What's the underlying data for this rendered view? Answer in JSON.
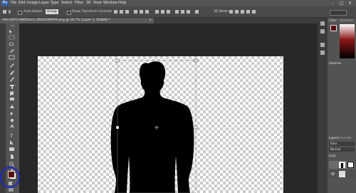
{
  "app": {
    "menus": [
      "File",
      "Edit",
      "Image",
      "Layer",
      "Type",
      "Select",
      "Filter",
      "3D",
      "View",
      "Window",
      "Help"
    ],
    "window_controls": [
      "–",
      "□",
      "✕"
    ]
  },
  "options_bar": {
    "auto_select_label": "Auto-Select:",
    "auto_select_value": "Group",
    "show_transform_label": "Show Transform Controls",
    "mode_3d_label": "3D Mode:"
  },
  "document_tab": {
    "title": "film 6075-6967lsm1-360ah5MVV9.png @ 16.7% (Layer 1, RGB/8) *",
    "close": "×"
  },
  "panels": {
    "color_tab": "Color",
    "swatches_tab": "Swatches",
    "libraries_tab": "Libraries",
    "layers_tab": "Layers",
    "channels_tab": "Channels",
    "paths_tab": "Paths",
    "kind_label": "Kind",
    "blend_mode": "Normal",
    "lock_label": "Lock:"
  },
  "colors": {
    "foreground": "#5a1010",
    "background": "#ffffff",
    "annotation_circle": "#1a2ac8"
  }
}
